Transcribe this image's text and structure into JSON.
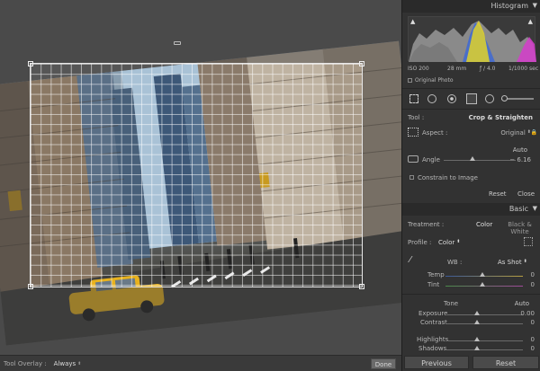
{
  "toolbar": {
    "overlay_label": "Tool Overlay :",
    "overlay_value": "Always",
    "done_label": "Done"
  },
  "histogram": {
    "title": "Histogram",
    "iso": "ISO 200",
    "focal": "28 mm",
    "aperture": "ƒ / 4.0",
    "shutter": "1/1000 sec",
    "original_photo_label": "Original Photo"
  },
  "crop": {
    "tool_label": "Tool :",
    "tool_value": "Crop & Straighten",
    "aspect_label": "Aspect :",
    "aspect_value": "Original",
    "auto_label": "Auto",
    "angle_label": "Angle",
    "angle_value": "6.16",
    "constrain_label": "Constrain to Image",
    "reset_label": "Reset",
    "close_label": "Close"
  },
  "basic": {
    "title": "Basic",
    "treatment_label": "Treatment :",
    "color_label": "Color",
    "bw_label": "Black & White",
    "profile_label": "Profile :",
    "profile_value": "Color",
    "wb_label": "WB :",
    "wb_value": "As Shot",
    "temp_label": "Temp",
    "temp_value": "0",
    "tint_label": "Tint",
    "tint_value": "0",
    "tone_label": "Tone",
    "tone_auto_label": "Auto",
    "exposure_label": "Exposure",
    "exposure_value": "0.00",
    "contrast_label": "Contrast",
    "contrast_value": "0",
    "highlights_label": "Highlights",
    "highlights_value": "0",
    "shadows_label": "Shadows",
    "shadows_value": "0"
  },
  "footer": {
    "previous_label": "Previous",
    "reset_label": "Reset"
  },
  "colors": {
    "panel_bg": "#323232",
    "header_bg": "#2a2a2a",
    "canvas_bg": "#565656"
  }
}
